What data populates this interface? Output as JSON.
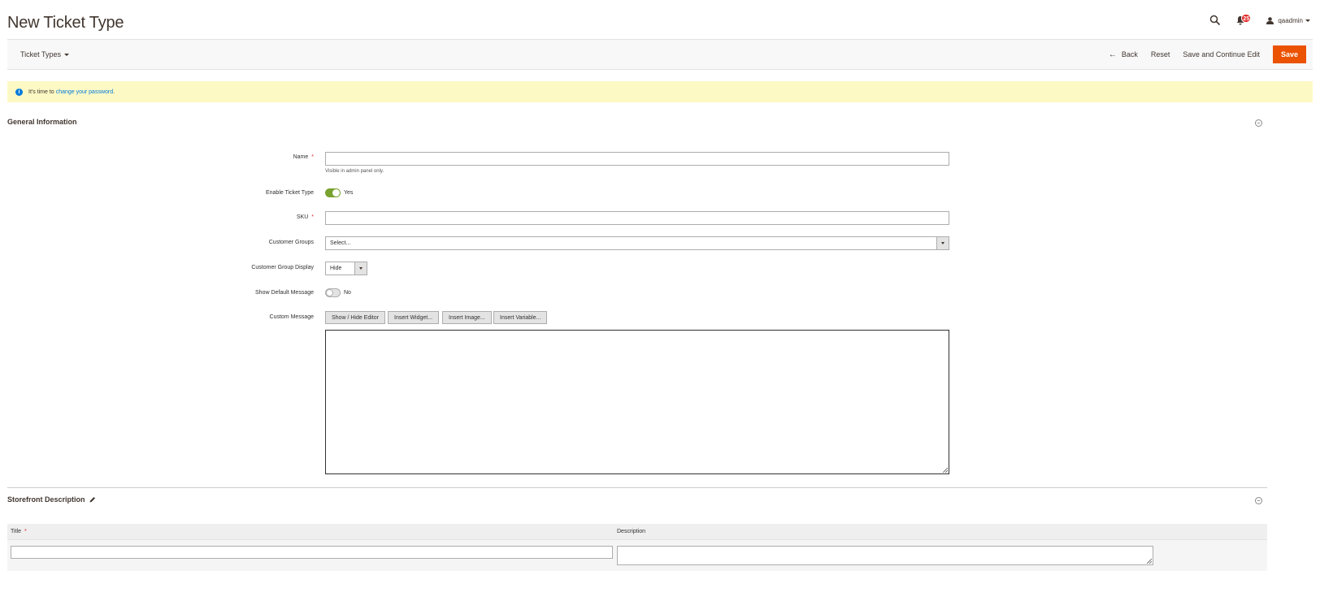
{
  "header": {
    "title": "New Ticket Type",
    "notification_count": "25",
    "username": "qaadmin"
  },
  "actions_bar": {
    "store_switcher": "Ticket Types",
    "back_label": "Back",
    "reset_label": "Reset",
    "save_continue_label": "Save and Continue Edit",
    "save_label": "Save"
  },
  "message": {
    "text": "It's time to",
    "link_text": "change your password",
    "suffix": "."
  },
  "general": {
    "title": "General Information",
    "fields": {
      "name_label": "Name",
      "name_value": "",
      "name_note": "Visible in admin panel only.",
      "enable_label": "Enable Ticket Type",
      "enable_value": "Yes",
      "sku_label": "SKU",
      "sku_value": "",
      "customer_groups_label": "Customer Groups",
      "customer_groups_value": "Select...",
      "group_display_label": "Customer Group Display",
      "group_display_value": "Hide",
      "show_default_label": "Show Default Message",
      "show_default_value": "No",
      "custom_message_label": "Custom Message"
    },
    "editor_buttons": [
      "Show / Hide Editor",
      "Insert Widget...",
      "Insert Image...",
      "Insert Variable..."
    ]
  },
  "storefront": {
    "title": "Storefront Description",
    "columns": [
      "Title",
      "Description"
    ],
    "row": {
      "title": "",
      "description": ""
    }
  },
  "colors": {
    "primary": "#eb5202",
    "toggle_on": "#79a22e",
    "link": "#007bdb",
    "message_bg": "#fdf9c4"
  }
}
